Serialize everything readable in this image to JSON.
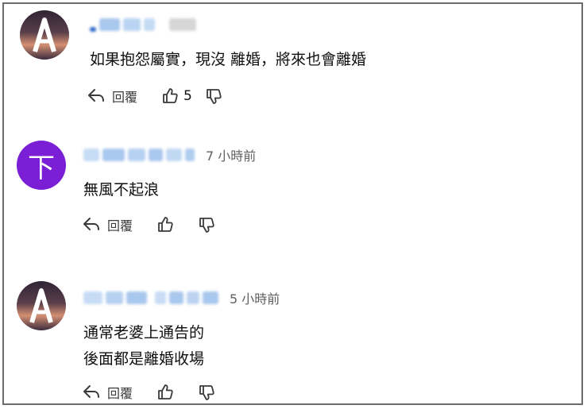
{
  "comments": [
    {
      "time": "",
      "text": "如果抱怨屬實，現沒 離婚，將來也會離婚",
      "reply_label": "回覆",
      "like_count": "5"
    },
    {
      "avatar_letter": "下",
      "time": "7 小時前",
      "text": "無風不起浪",
      "reply_label": "回覆",
      "like_count": ""
    },
    {
      "time": "5 小時前",
      "text": "通常老婆上通告的\n後面都是離婚收場",
      "reply_label": "回覆",
      "like_count": ""
    }
  ],
  "colors": {
    "avatar_purple": "#7b1fd6",
    "avatar_a_bg": "#3a2c3e",
    "blurred_name": "#a9c8ee",
    "text": "#0f0f0f",
    "meta": "#606060"
  },
  "icons": {
    "reply": "reply-arrow-icon",
    "like": "thumbs-up-icon",
    "dislike": "thumbs-down-icon"
  }
}
